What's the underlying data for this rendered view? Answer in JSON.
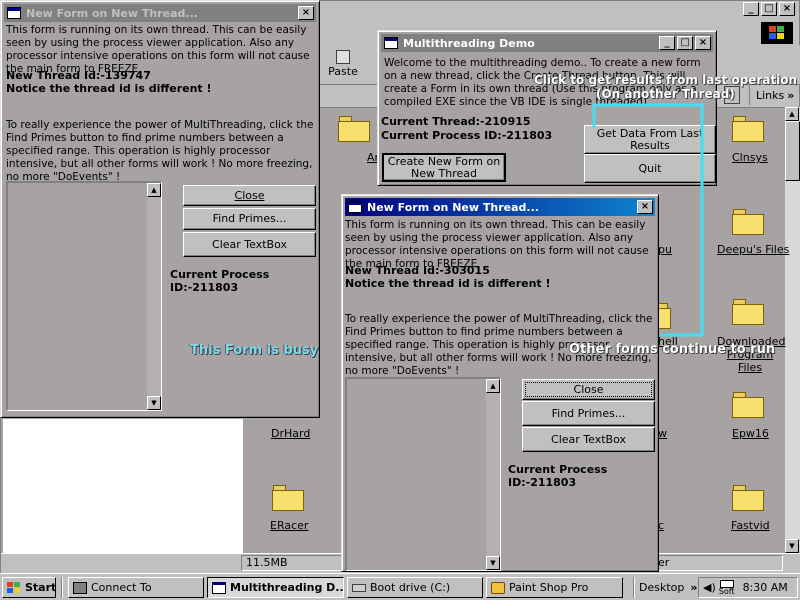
{
  "explorer": {
    "toolbar_paste": "Paste",
    "links": "Links",
    "links_chevron": "»",
    "status_size": "11.5MB",
    "status_right": "er",
    "address_dropdown": "▼",
    "folders": [
      {
        "label": "Clnsys"
      },
      {
        "label": "Deepu's Files"
      },
      {
        "label": "Downloaded Program Files"
      },
      {
        "label": "Epw16"
      },
      {
        "label": "Fastvid"
      },
      {
        "label": "DrHard"
      },
      {
        "label": "ERacer"
      },
      {
        "label": "Ar"
      },
      {
        "label": "pu"
      },
      {
        "label": "hell"
      },
      {
        "label": "w"
      },
      {
        "label": "c"
      }
    ]
  },
  "form1": {
    "title": "New Form on New Thread...",
    "intro": "This form is running on its own thread. This can be easily seen by using the process viewer application. Also any processor intensive operations on this form will not cause the main form to FREEZE",
    "thread_id": "New Thread Id:-139747",
    "notice": "Notice the thread id is different !",
    "desc": "To really experience the power of MultiThreading, click the Find Primes button to find prime numbers between a specified range. This operation is highly processor intensive, but all other forms will work ! No more freezing, no more \"DoEvents\" !",
    "close_btn": "Close",
    "primes_btn": "Find Primes...",
    "clear_btn": "Clear TextBox",
    "process": "Current Process ID:-211803",
    "close_icon": "×"
  },
  "demo": {
    "title": "Multithreading Demo",
    "intro": "Welcome to the multithreading demo.. To create a new form on a new thread, click the Create Thread button. This will create a Form in its own thread (Use this program only as a compiled EXE since the VB IDE is single threaded)...",
    "current_thread": "Current Thread:-210915",
    "current_process": "Current Process ID:-211803",
    "create_btn": "Create New Form on New Thread",
    "getdata_btn": "Get Data From Last Results",
    "quit_btn": "Quit",
    "min": "_",
    "max": "□",
    "close": "×"
  },
  "form2": {
    "title": "New Form on New Thread...",
    "intro": "This form is running on its own thread. This can be easily seen by using the process viewer application. Also any processor intensive operations on this form will not cause the main form to FREEZE",
    "thread_id": "New Thread Id:-303015",
    "notice": "Notice the thread id is different !",
    "desc": "To really experience the power of MultiThreading, click the Find Primes button to find prime numbers between a specified range. This operation is highly processor intensive, but all other forms will work ! No more freezing, no more \"DoEvents\" !",
    "close_btn": "Close",
    "primes_btn": "Find Primes...",
    "clear_btn": "Clear TextBox",
    "process": "Current Process ID:-211803",
    "close_icon": "×"
  },
  "annotations": {
    "busy": "This Form is busy",
    "click_line1": "Click to get results from last operation",
    "click_line2": "(On another Thread)",
    "other": "Other forms continue to run"
  },
  "taskbar": {
    "start": "Start",
    "items": [
      {
        "label": "Connect To"
      },
      {
        "label": "Multithreading D..."
      },
      {
        "label": "Boot drive (C:)"
      },
      {
        "label": "Paint Shop Pro"
      }
    ],
    "desktop": "Desktop",
    "desktop_chevron": "»",
    "soft": "Soft",
    "clock": "8:30 AM"
  },
  "colors": {
    "accent_annotation_line": "#40e0f0",
    "annotation_busy": "#80d8f0",
    "active_title_start": "#000080",
    "active_title_end": "#1084d0"
  }
}
